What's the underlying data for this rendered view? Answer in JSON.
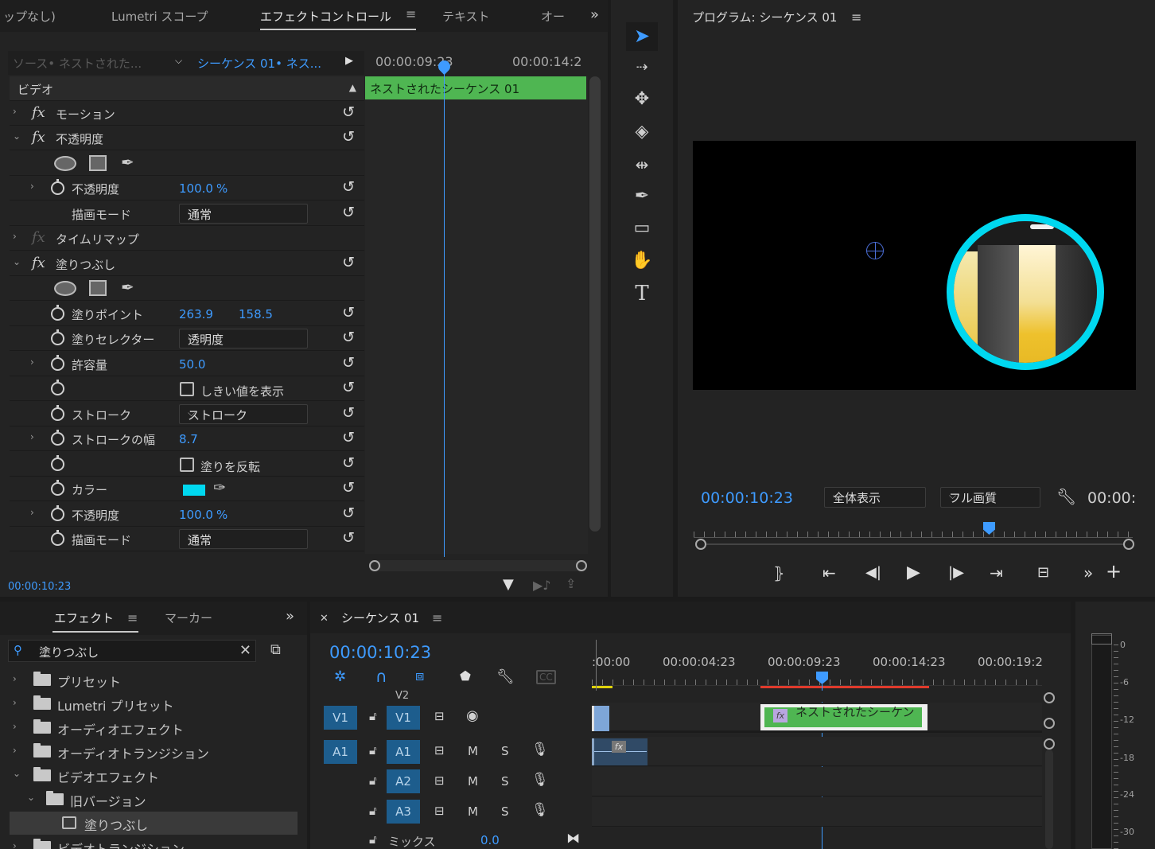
{
  "effect_controls": {
    "tabs": [
      "ップなし)",
      "Lumetri スコープ",
      "エフェクトコントロール",
      "テキスト",
      "オー"
    ],
    "source_label": "ソース• ネストされた...",
    "sequence_label": "シーケンス 01• ネス...",
    "timecode_start": "00:00:09:23",
    "timecode_end": "00:00:14:2",
    "clip_label": "ネストされたシーケンス 01",
    "section_video": "ビデオ",
    "motion": "モーション",
    "opacity": "不透明度",
    "opacity_value": "100.0",
    "percent": "%",
    "blend_mode_label": "描画モード",
    "blend_mode_value": "通常",
    "time_remap": "タイムリマップ",
    "fill": "塗りつぶし",
    "fill_point_label": "塗りポイント",
    "fill_point_x": "263.9",
    "fill_point_y": "158.5",
    "fill_selector_label": "塗りセレクター",
    "fill_selector_value": "透明度",
    "tolerance_label": "許容量",
    "tolerance_value": "50.0",
    "show_threshold": "しきい値を表示",
    "stroke_label": "ストローク",
    "stroke_value": "ストローク",
    "stroke_width_label": "ストロークの幅",
    "stroke_width_value": "8.7",
    "invert_fill": "塗りを反転",
    "color_label": "カラー",
    "color_value": "#00d8f0",
    "opacity2_value": "100.0",
    "current_time": "00:00:10:23"
  },
  "program_monitor": {
    "title": "プログラム: シーケンス 01",
    "timecode": "00:00:10:23",
    "fit_value": "全体表示",
    "quality_value": "フル画質",
    "duration": "00:00:"
  },
  "effects_panel": {
    "tabs": [
      "エフェクト",
      "マーカー"
    ],
    "search_value": "塗りつぶし",
    "tree": [
      {
        "label": "プリセット"
      },
      {
        "label": "Lumetri プリセット"
      },
      {
        "label": "オーディオエフェクト"
      },
      {
        "label": "オーディオトランジション"
      },
      {
        "label": "ビデオエフェクト"
      },
      {
        "label": "旧バージョン"
      },
      {
        "label": "塗りつぶし"
      },
      {
        "label": "ビデオトランジション"
      }
    ]
  },
  "timeline": {
    "title": "シーケンス 01",
    "timecode": "00:00:10:23",
    "ruler": [
      ":00:00",
      "00:00:04:23",
      "00:00:09:23",
      "00:00:14:23",
      "00:00:19:2"
    ],
    "tracks": {
      "v2": "V2",
      "v1": "V1",
      "a1": "A1",
      "a2": "A2",
      "a3": "A3",
      "m": "M",
      "s": "S",
      "mix": "ミックス",
      "mix_value": "0.0"
    },
    "clip_label": "ネストされたシーケン",
    "fx_badge": "fx"
  },
  "audio_meter": {
    "labels": [
      "0",
      "-6",
      "-12",
      "-18",
      "-24",
      "-30"
    ]
  }
}
